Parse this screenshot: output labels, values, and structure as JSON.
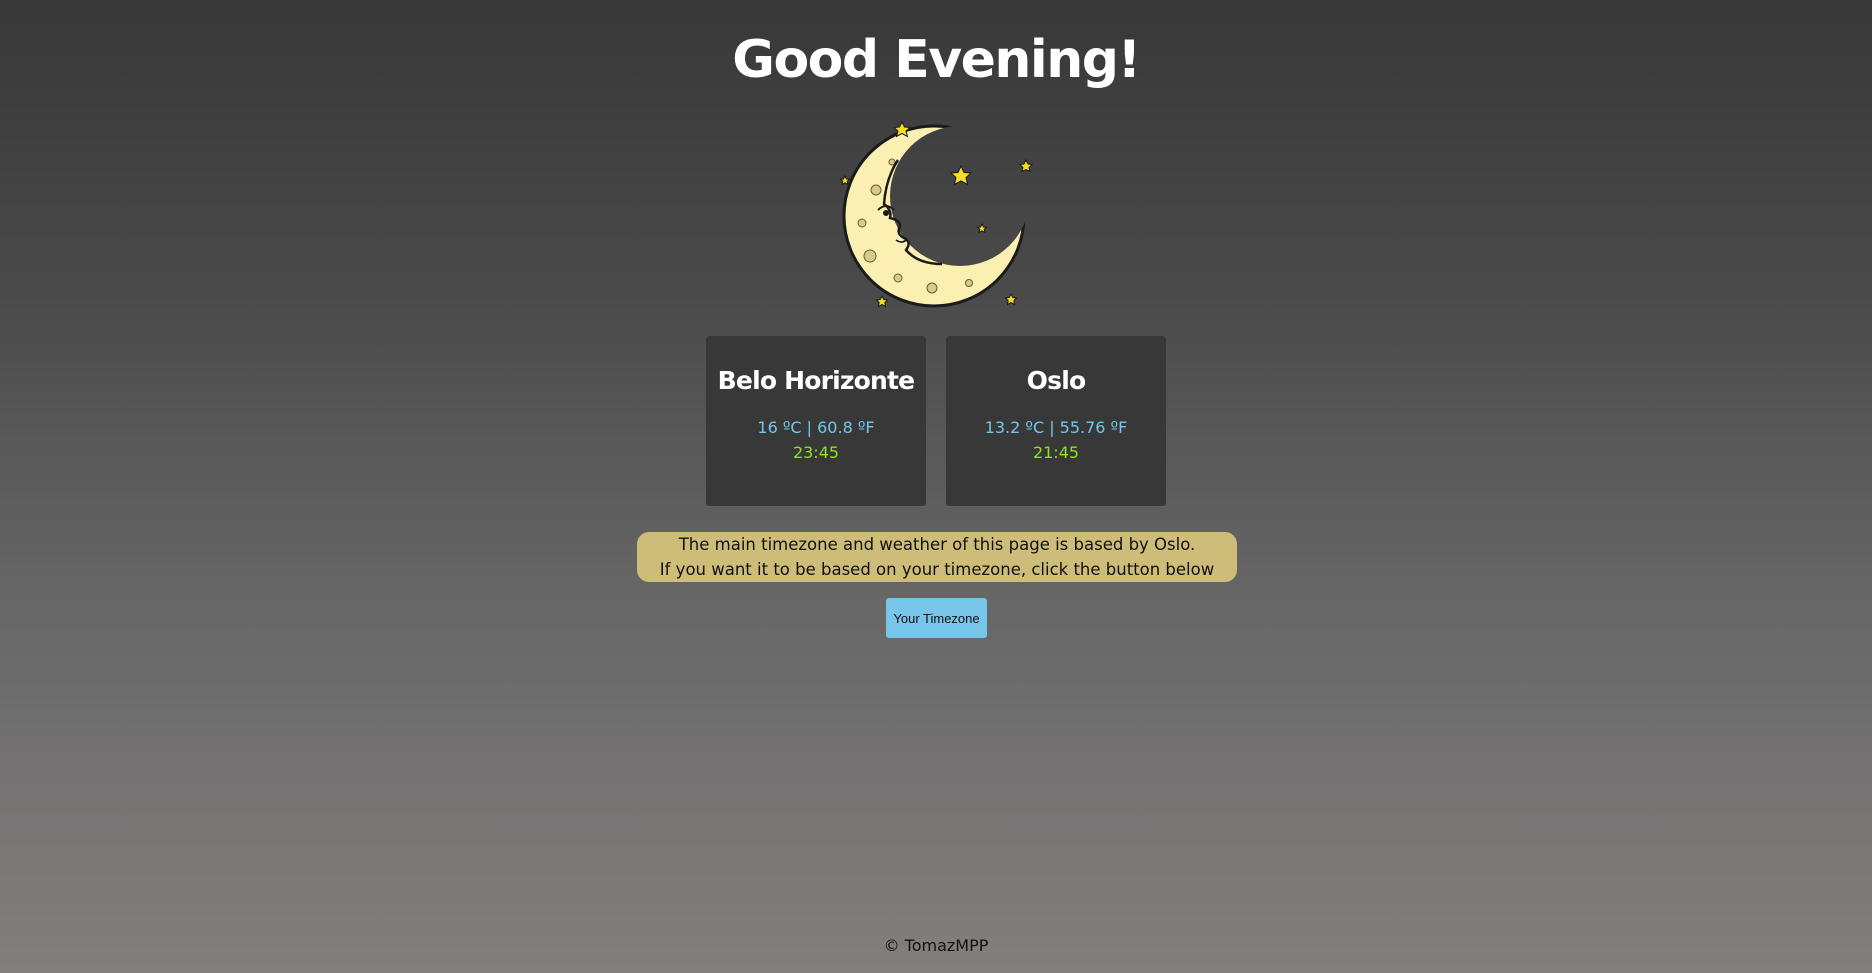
{
  "greeting": "Good Evening!",
  "illustration": {
    "icon": "crescent-moon-with-stars-icon",
    "moon_color": "#fbf0b2",
    "star_color": "#f5dc28"
  },
  "cities": [
    {
      "name": "Belo Horizonte",
      "temperature": "16 ºC | 60.8 ºF",
      "time": "23:45"
    },
    {
      "name": "Oslo",
      "temperature": "13.2 ºC | 55.76 ºF",
      "time": "21:45"
    }
  ],
  "notice": {
    "line1": "The main timezone and weather of this page is based by Oslo.",
    "line2": "If you want it to be based on your timezone, click the button below"
  },
  "timezone_button": "Your Timezone",
  "footer": "© TomazMPP",
  "colors": {
    "card_bg": "#383838",
    "temperature": "#73c7ee",
    "time": "#8ee31c",
    "notice_bg": "#cdbd78",
    "button_bg": "#77c5e8"
  }
}
